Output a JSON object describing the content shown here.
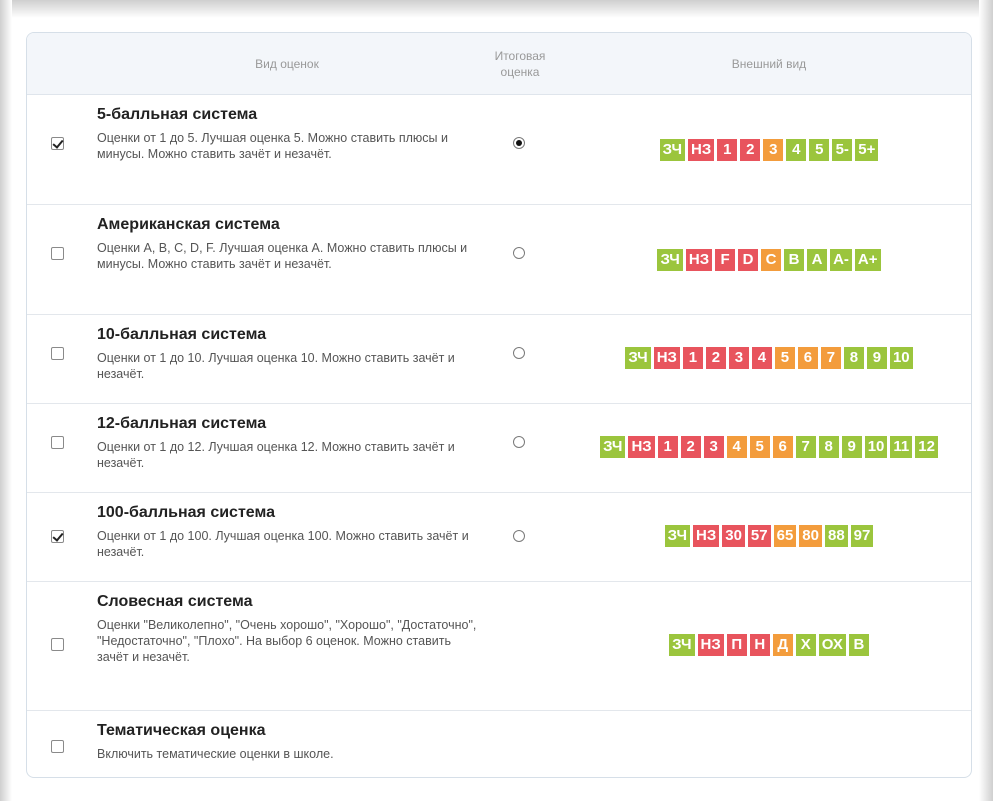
{
  "header": {
    "col_type": "Вид оценок",
    "col_final_line1": "Итоговая",
    "col_final_line2": "оценка",
    "col_view": "Внешний вид"
  },
  "colors": {
    "green": "#9bc53d",
    "red": "#e8545d",
    "orange": "#f39c3c"
  },
  "rows": [
    {
      "title": "5-балльная система",
      "desc": "Оценки от 1 до 5. Лучшая оценка 5. Можно ставить плюсы и минусы. Можно ставить зачёт и незачёт.",
      "checked": true,
      "final": true,
      "grades": [
        {
          "label": "ЗЧ",
          "color": "green"
        },
        {
          "label": "НЗ",
          "color": "red"
        },
        {
          "label": "1",
          "color": "red"
        },
        {
          "label": "2",
          "color": "red"
        },
        {
          "label": "3",
          "color": "orange"
        },
        {
          "label": "4",
          "color": "green"
        },
        {
          "label": "5",
          "color": "green"
        },
        {
          "label": "5-",
          "color": "green"
        },
        {
          "label": "5+",
          "color": "green"
        }
      ]
    },
    {
      "title": "Американская система",
      "desc": "Оценки A, B, C, D, F. Лучшая оценка A. Можно ставить плюсы и минусы. Можно ставить зачёт и незачёт.",
      "checked": false,
      "final": false,
      "grades": [
        {
          "label": "ЗЧ",
          "color": "green"
        },
        {
          "label": "НЗ",
          "color": "red"
        },
        {
          "label": "F",
          "color": "red"
        },
        {
          "label": "D",
          "color": "red"
        },
        {
          "label": "C",
          "color": "orange"
        },
        {
          "label": "B",
          "color": "green"
        },
        {
          "label": "A",
          "color": "green"
        },
        {
          "label": "A-",
          "color": "green"
        },
        {
          "label": "A+",
          "color": "green"
        }
      ]
    },
    {
      "title": "10-балльная система",
      "desc": "Оценки от 1 до 10. Лучшая оценка 10. Можно ставить зачёт и незачёт.",
      "checked": false,
      "final": false,
      "grades": [
        {
          "label": "ЗЧ",
          "color": "green"
        },
        {
          "label": "НЗ",
          "color": "red"
        },
        {
          "label": "1",
          "color": "red"
        },
        {
          "label": "2",
          "color": "red"
        },
        {
          "label": "3",
          "color": "red"
        },
        {
          "label": "4",
          "color": "red"
        },
        {
          "label": "5",
          "color": "orange"
        },
        {
          "label": "6",
          "color": "orange"
        },
        {
          "label": "7",
          "color": "orange"
        },
        {
          "label": "8",
          "color": "green"
        },
        {
          "label": "9",
          "color": "green"
        },
        {
          "label": "10",
          "color": "green"
        }
      ]
    },
    {
      "title": "12-балльная система",
      "desc": "Оценки от 1 до 12. Лучшая оценка 12. Можно ставить зачёт и незачёт.",
      "checked": false,
      "final": false,
      "grades": [
        {
          "label": "ЗЧ",
          "color": "green"
        },
        {
          "label": "НЗ",
          "color": "red"
        },
        {
          "label": "1",
          "color": "red"
        },
        {
          "label": "2",
          "color": "red"
        },
        {
          "label": "3",
          "color": "red"
        },
        {
          "label": "4",
          "color": "orange"
        },
        {
          "label": "5",
          "color": "orange"
        },
        {
          "label": "6",
          "color": "orange"
        },
        {
          "label": "7",
          "color": "green"
        },
        {
          "label": "8",
          "color": "green"
        },
        {
          "label": "9",
          "color": "green"
        },
        {
          "label": "10",
          "color": "green"
        },
        {
          "label": "11",
          "color": "green"
        },
        {
          "label": "12",
          "color": "green"
        }
      ]
    },
    {
      "title": "100-балльная система",
      "desc": "Оценки от 1 до 100. Лучшая оценка 100. Можно ставить зачёт и незачёт.",
      "checked": true,
      "final": false,
      "grades": [
        {
          "label": "ЗЧ",
          "color": "green"
        },
        {
          "label": "НЗ",
          "color": "red"
        },
        {
          "label": "30",
          "color": "red"
        },
        {
          "label": "57",
          "color": "red"
        },
        {
          "label": "65",
          "color": "orange"
        },
        {
          "label": "80",
          "color": "orange"
        },
        {
          "label": "88",
          "color": "green"
        },
        {
          "label": "97",
          "color": "green"
        }
      ]
    },
    {
      "title": "Словесная система",
      "desc": "Оценки \"Великолепно\", \"Очень хорошо\", \"Хорошо\", \"Достаточно\", \"Недостаточно\", \"Плохо\". На выбор 6 оценок. Можно ставить зачёт и незачёт.",
      "checked": false,
      "final": null,
      "grades": [
        {
          "label": "ЗЧ",
          "color": "green"
        },
        {
          "label": "НЗ",
          "color": "red"
        },
        {
          "label": "П",
          "color": "red"
        },
        {
          "label": "Н",
          "color": "red"
        },
        {
          "label": "Д",
          "color": "orange"
        },
        {
          "label": "Х",
          "color": "green"
        },
        {
          "label": "ОХ",
          "color": "green"
        },
        {
          "label": "В",
          "color": "green"
        }
      ]
    },
    {
      "title": "Тематическая оценка",
      "desc": "Включить тематические оценки в школе.",
      "checked": false,
      "final": null,
      "grades": []
    }
  ]
}
